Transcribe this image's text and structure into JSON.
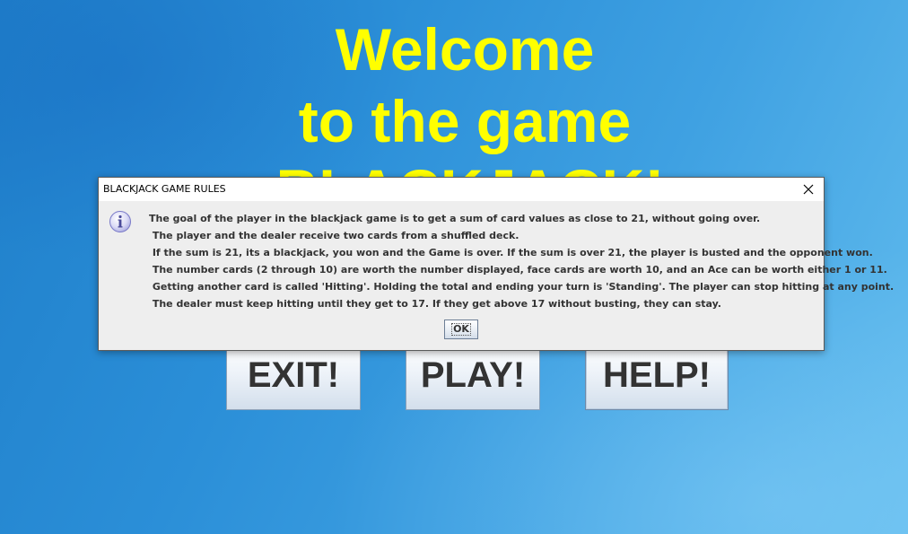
{
  "window": {
    "title_lines": [
      "Welcome",
      "to the game",
      "BLACKJACK!"
    ],
    "title_color": "#ffff00",
    "background_color": "#2b8fd8"
  },
  "menu": {
    "exit_label": "EXIT!",
    "play_label": "PLAY!",
    "help_label": "HELP!"
  },
  "dialog": {
    "title": "BLACKJACK GAME RULES",
    "icon": "info-icon",
    "close_icon": "close-icon",
    "lines": [
      "The goal of the player in the blackjack game is to get a sum of card values as close to 21, without going over.",
      " The player and the dealer receive two cards from a shuffled deck.",
      " If the sum is 21, its a blackjack, you won and the Game is over. If the sum is over 21, the player is busted and the opponent won.",
      " The number cards (2 through 10) are worth the number displayed, face cards are worth 10, and an Ace can be worth either 1 or 11.",
      " Getting another card is called 'Hitting'. Holding the total and ending your turn is 'Standing'. The player can stop hitting at any point.",
      " The dealer must keep hitting until they get to 17. If they get above 17 without busting, they can stay."
    ],
    "ok_label": "OK"
  }
}
